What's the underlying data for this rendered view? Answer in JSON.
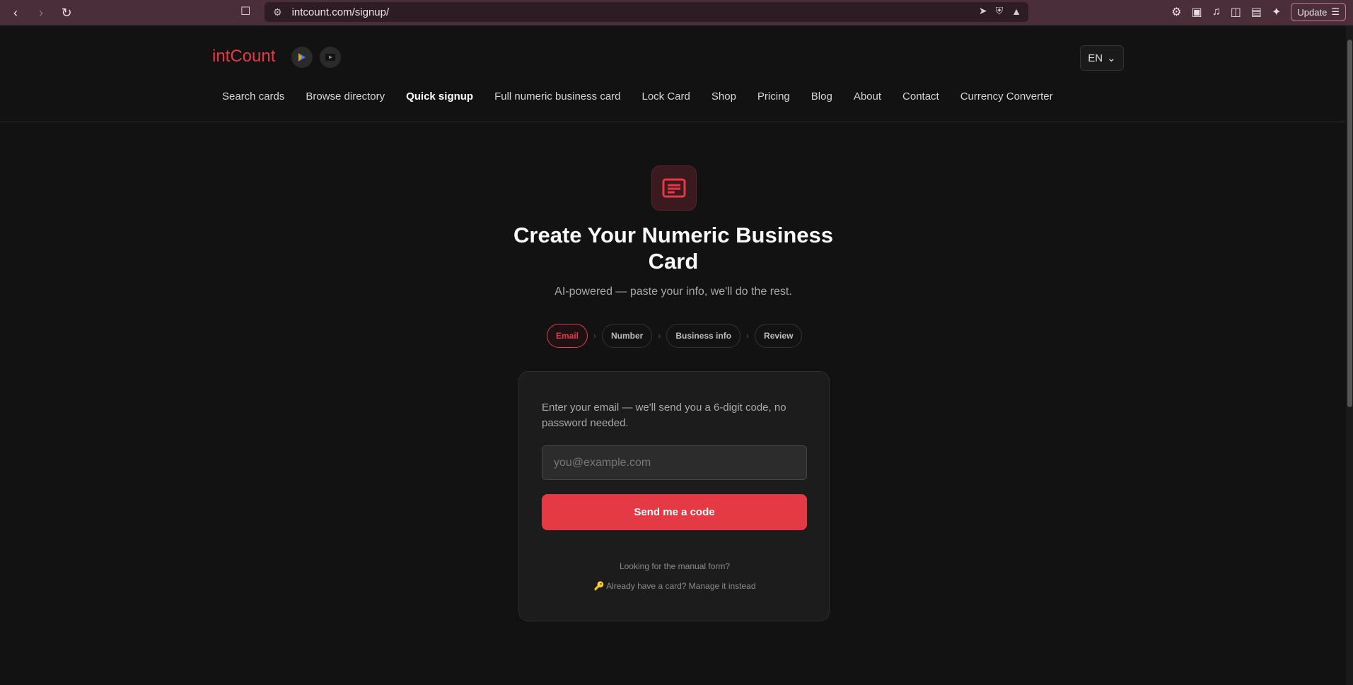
{
  "browser": {
    "url": "intcount.com/signup/",
    "update_label": "Update"
  },
  "header": {
    "logo": "intCount",
    "lang": "EN",
    "nav": [
      "Search cards",
      "Browse directory",
      "Quick signup",
      "Full numeric business card",
      "Lock Card",
      "Shop",
      "Pricing",
      "Blog",
      "About",
      "Contact",
      "Currency Converter"
    ],
    "active_nav": "Quick signup"
  },
  "main": {
    "title": "Create Your Numeric Business Card",
    "subtitle": "AI-powered — paste your info, we'll do the rest.",
    "steps": [
      "Email",
      "Number",
      "Business info",
      "Review"
    ],
    "active_step": "Email",
    "card": {
      "text": "Enter your email — we'll send you a 6-digit code, no password needed.",
      "email_placeholder": "you@example.com",
      "button": "Send me a code",
      "manual": "Looking for the manual form?",
      "manage": "🔑 Already have a card? Manage it instead"
    }
  },
  "colors": {
    "accent": "#e63946",
    "chrome": "#4a2f3a",
    "background": "#121212"
  }
}
